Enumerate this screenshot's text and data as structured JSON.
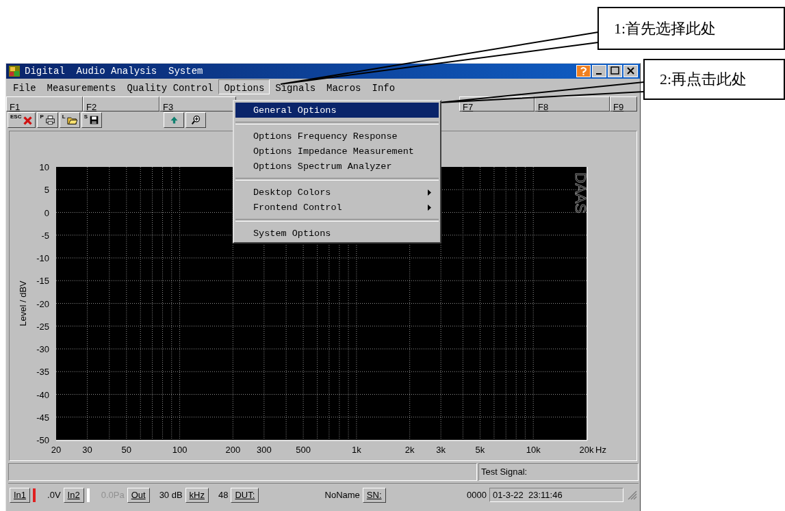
{
  "callouts": [
    {
      "text": "1:首先选择此处"
    },
    {
      "text": "2:再点击此处"
    }
  ],
  "window": {
    "title": "Digital  Audio Analysis  System"
  },
  "menu_bar": [
    {
      "label": "File",
      "selected": false
    },
    {
      "label": "Measurements",
      "selected": false
    },
    {
      "label": "Quality Control",
      "selected": false
    },
    {
      "label": "Options",
      "selected": true
    },
    {
      "label": "Signals",
      "selected": false
    },
    {
      "label": "Macros",
      "selected": false
    },
    {
      "label": "Info",
      "selected": false
    }
  ],
  "function_keys_left": [
    "F1",
    "F2",
    "F3"
  ],
  "function_keys_right": [
    "F7",
    "F8",
    "F9"
  ],
  "toolbar": [
    {
      "kind": "delete",
      "key": "ESC"
    },
    {
      "kind": "print",
      "key": "P"
    },
    {
      "kind": "open",
      "key": "L"
    },
    {
      "kind": "save",
      "key": "S"
    },
    {
      "kind": "up"
    },
    {
      "kind": "zoom"
    }
  ],
  "options_menu": [
    {
      "kind": "item",
      "label": "General Options",
      "selected": true,
      "submenu": false
    },
    {
      "kind": "separator"
    },
    {
      "kind": "item",
      "label": "Options Frequency Response",
      "selected": false,
      "submenu": false
    },
    {
      "kind": "item",
      "label": "Options Impedance Measurement",
      "selected": false,
      "submenu": false
    },
    {
      "kind": "item",
      "label": "Options Spectrum Analyzer",
      "selected": false,
      "submenu": false
    },
    {
      "kind": "separator"
    },
    {
      "kind": "item",
      "label": "Desktop Colors",
      "selected": false,
      "submenu": true
    },
    {
      "kind": "item",
      "label": "Frontend Control",
      "selected": false,
      "submenu": true
    },
    {
      "kind": "separator"
    },
    {
      "kind": "item",
      "label": "System Options",
      "selected": false,
      "submenu": false
    }
  ],
  "plot": {
    "logo": "DAAS",
    "y_axis_title": "Level / dBV",
    "x_unit": "Hz",
    "x_axis_labels": [
      "20",
      "30",
      "50",
      "100",
      "200",
      "300",
      "500",
      "1k",
      "2k",
      "3k",
      "5k",
      "10k",
      "20k"
    ],
    "y_axis_labels": [
      "10",
      "5",
      "0",
      "-5",
      "-10",
      "-15",
      "-20",
      "-25",
      "-30",
      "-35",
      "-40",
      "-45",
      "-50"
    ]
  },
  "status_bar": {
    "test_signal": "Test Signal:",
    "items": [
      {
        "kind": "button",
        "label": "In1"
      },
      {
        "kind": "indicator",
        "color": "#e02020"
      },
      {
        "kind": "value",
        "text": ".0V",
        "disabled": false
      },
      {
        "kind": "button",
        "label": "In2"
      },
      {
        "kind": "indicator",
        "color": "#ffffff"
      },
      {
        "kind": "value",
        "text": "0.0Pa",
        "disabled": true
      },
      {
        "kind": "button",
        "label": "Out"
      },
      {
        "kind": "value",
        "text": "30 dB",
        "disabled": false
      },
      {
        "kind": "button",
        "label": "kHz"
      },
      {
        "kind": "value",
        "text": "48",
        "disabled": false
      },
      {
        "kind": "button",
        "label": "DUT:"
      },
      {
        "kind": "wide",
        "text": "NoName",
        "disabled": false
      },
      {
        "kind": "button",
        "label": "SN:"
      },
      {
        "kind": "wide",
        "text": "0000",
        "disabled": false
      },
      {
        "kind": "clock",
        "text": "01-3-22  23:11:46",
        "disabled": false
      }
    ]
  }
}
